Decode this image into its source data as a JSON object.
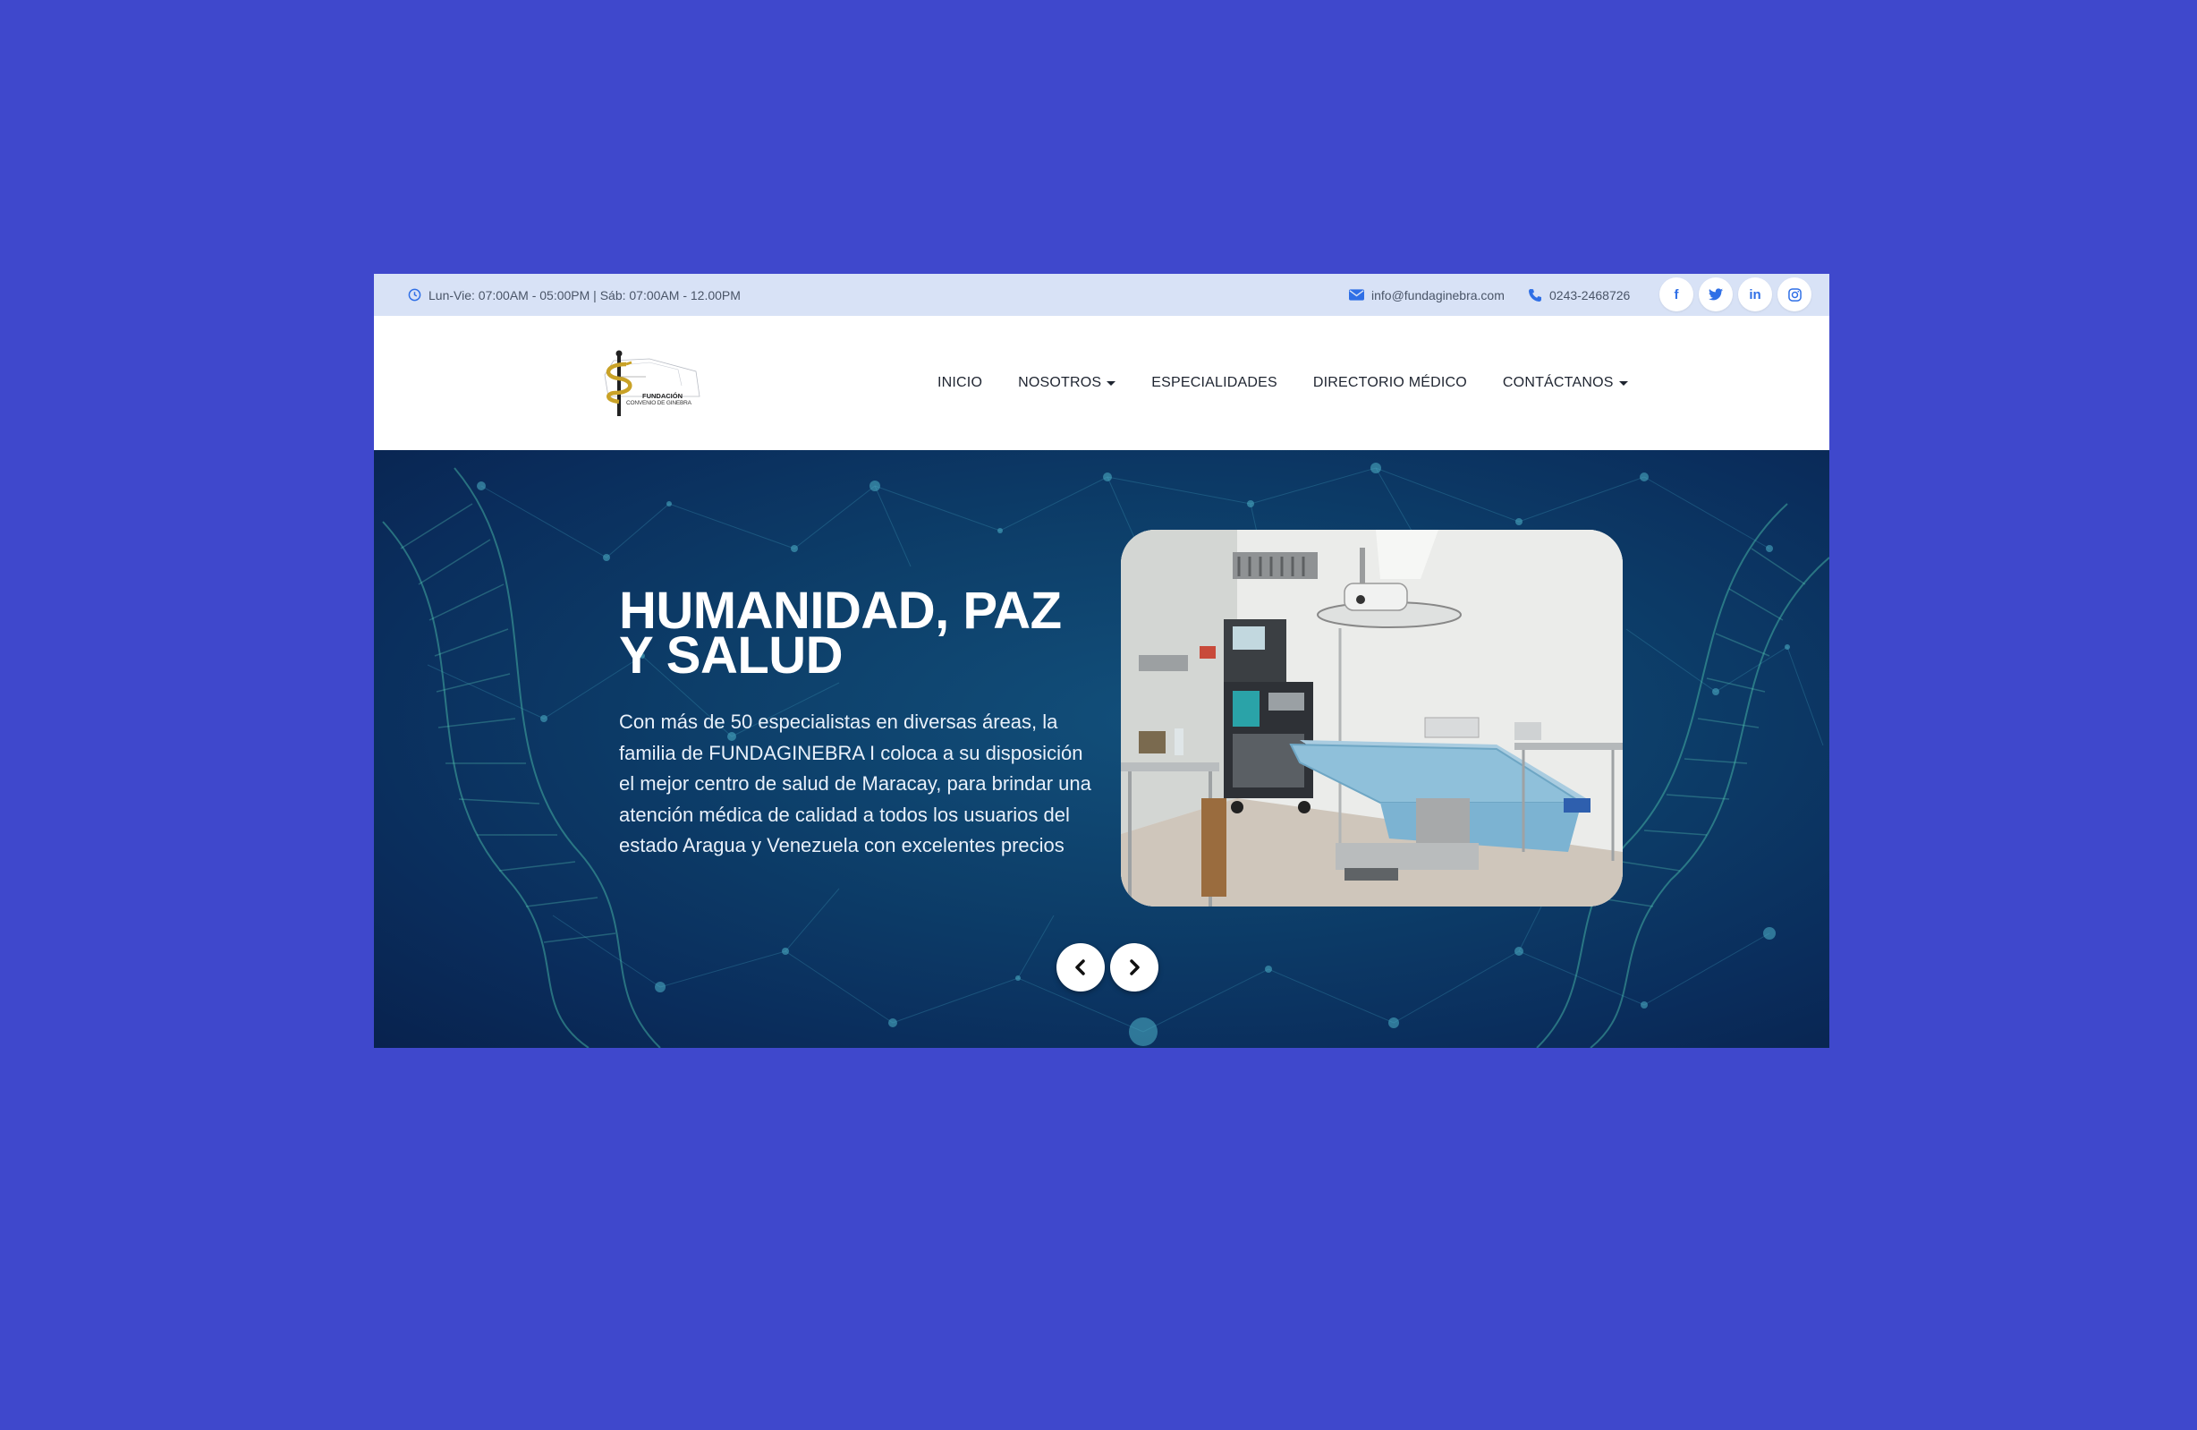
{
  "topbar": {
    "hours": "Lun-Vie: 07:00AM - 05:00PM | Sáb: 07:00AM - 12.00PM",
    "email": "info@fundaginebra.com",
    "phone": "0243-2468726",
    "social": [
      {
        "icon": "facebook-icon",
        "glyph": "f"
      },
      {
        "icon": "twitter-icon",
        "glyph": "t"
      },
      {
        "icon": "linkedin-icon",
        "glyph": "in"
      },
      {
        "icon": "instagram-icon",
        "glyph": "◎"
      }
    ]
  },
  "logo": {
    "line1": "FUNDACIÓN",
    "line2": "CONVENIO DE GINEBRA"
  },
  "nav": {
    "items": [
      {
        "label": "INICIO",
        "dropdown": false
      },
      {
        "label": "NOSOTROS",
        "dropdown": true
      },
      {
        "label": "ESPECIALIDADES",
        "dropdown": false
      },
      {
        "label": "DIRECTORIO MÉDICO",
        "dropdown": false
      },
      {
        "label": "CONTÁCTANOS",
        "dropdown": true
      }
    ]
  },
  "hero": {
    "title_line1": "HUMANIDAD, PAZ",
    "title_line2": "Y SALUD",
    "text": "Con más de 50 especialistas en diversas áreas, la familia de FUNDAGINEBRA I coloca a su disposición el mejor centro de salud de Maracay, para brindar una atención médica de calidad a todos los usuarios del estado Aragua y Venezuela con excelentes precios"
  },
  "colors": {
    "page_bg": "#3f48cc",
    "topbar_bg": "#d8e2f6",
    "accent": "#2f6fe6",
    "hero_bg": "#0d3f6a"
  }
}
